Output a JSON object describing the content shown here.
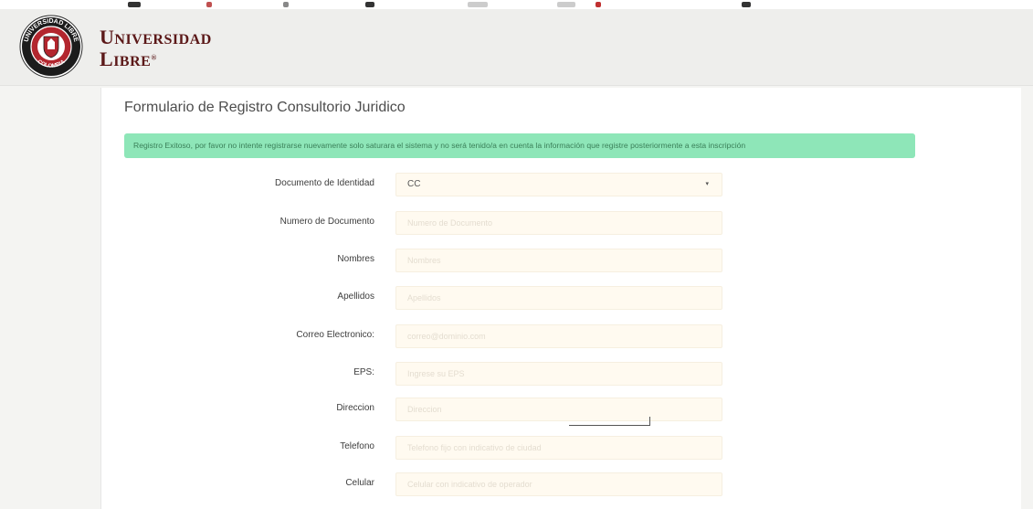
{
  "header": {
    "brand_line1_initial": "U",
    "brand_line1_rest": "NIVERSIDAD",
    "brand_line2_initial": "L",
    "brand_line2_rest": "IBRE",
    "brand_mark": "®",
    "seal_top_text": "UNIVERSIDAD LIBRE",
    "seal_bottom_text": "COLOMBIA"
  },
  "form": {
    "title": "Formulario de Registro Consultorio Juridico",
    "alert": "Registro Exitoso, por favor no intente registrarse nuevamente solo saturara el sistema y no será tenido/a en cuenta la información que registre posteriormente a esta inscripción",
    "fields": [
      {
        "label": "Documento de Identidad",
        "value": "CC",
        "type": "select",
        "caret": "▾"
      },
      {
        "label": "Numero de Documento",
        "placeholder": "Numero de Documento",
        "type": "input"
      },
      {
        "label": "Nombres",
        "placeholder": "Nombres",
        "type": "input"
      },
      {
        "label": "Apellidos",
        "placeholder": "Apellidos",
        "type": "input"
      },
      {
        "label": "Correo Electronico:",
        "placeholder": "correo@dominio.com",
        "type": "input"
      },
      {
        "label": "EPS:",
        "placeholder": "Ingrese su EPS",
        "type": "input"
      },
      {
        "label": "Direccion",
        "placeholder": "Direccion",
        "type": "input"
      },
      {
        "label": "Telefono",
        "placeholder": "Telefono fijo con indicativo de ciudad",
        "type": "input"
      },
      {
        "label": "Celular",
        "placeholder": "Celular con indicativo de operador",
        "type": "input"
      }
    ]
  },
  "colors": {
    "brand": "#5b1818",
    "alert_bg": "#8ee6b8",
    "alert_text": "#3a7f58",
    "field_bg": "#fffaf0"
  }
}
